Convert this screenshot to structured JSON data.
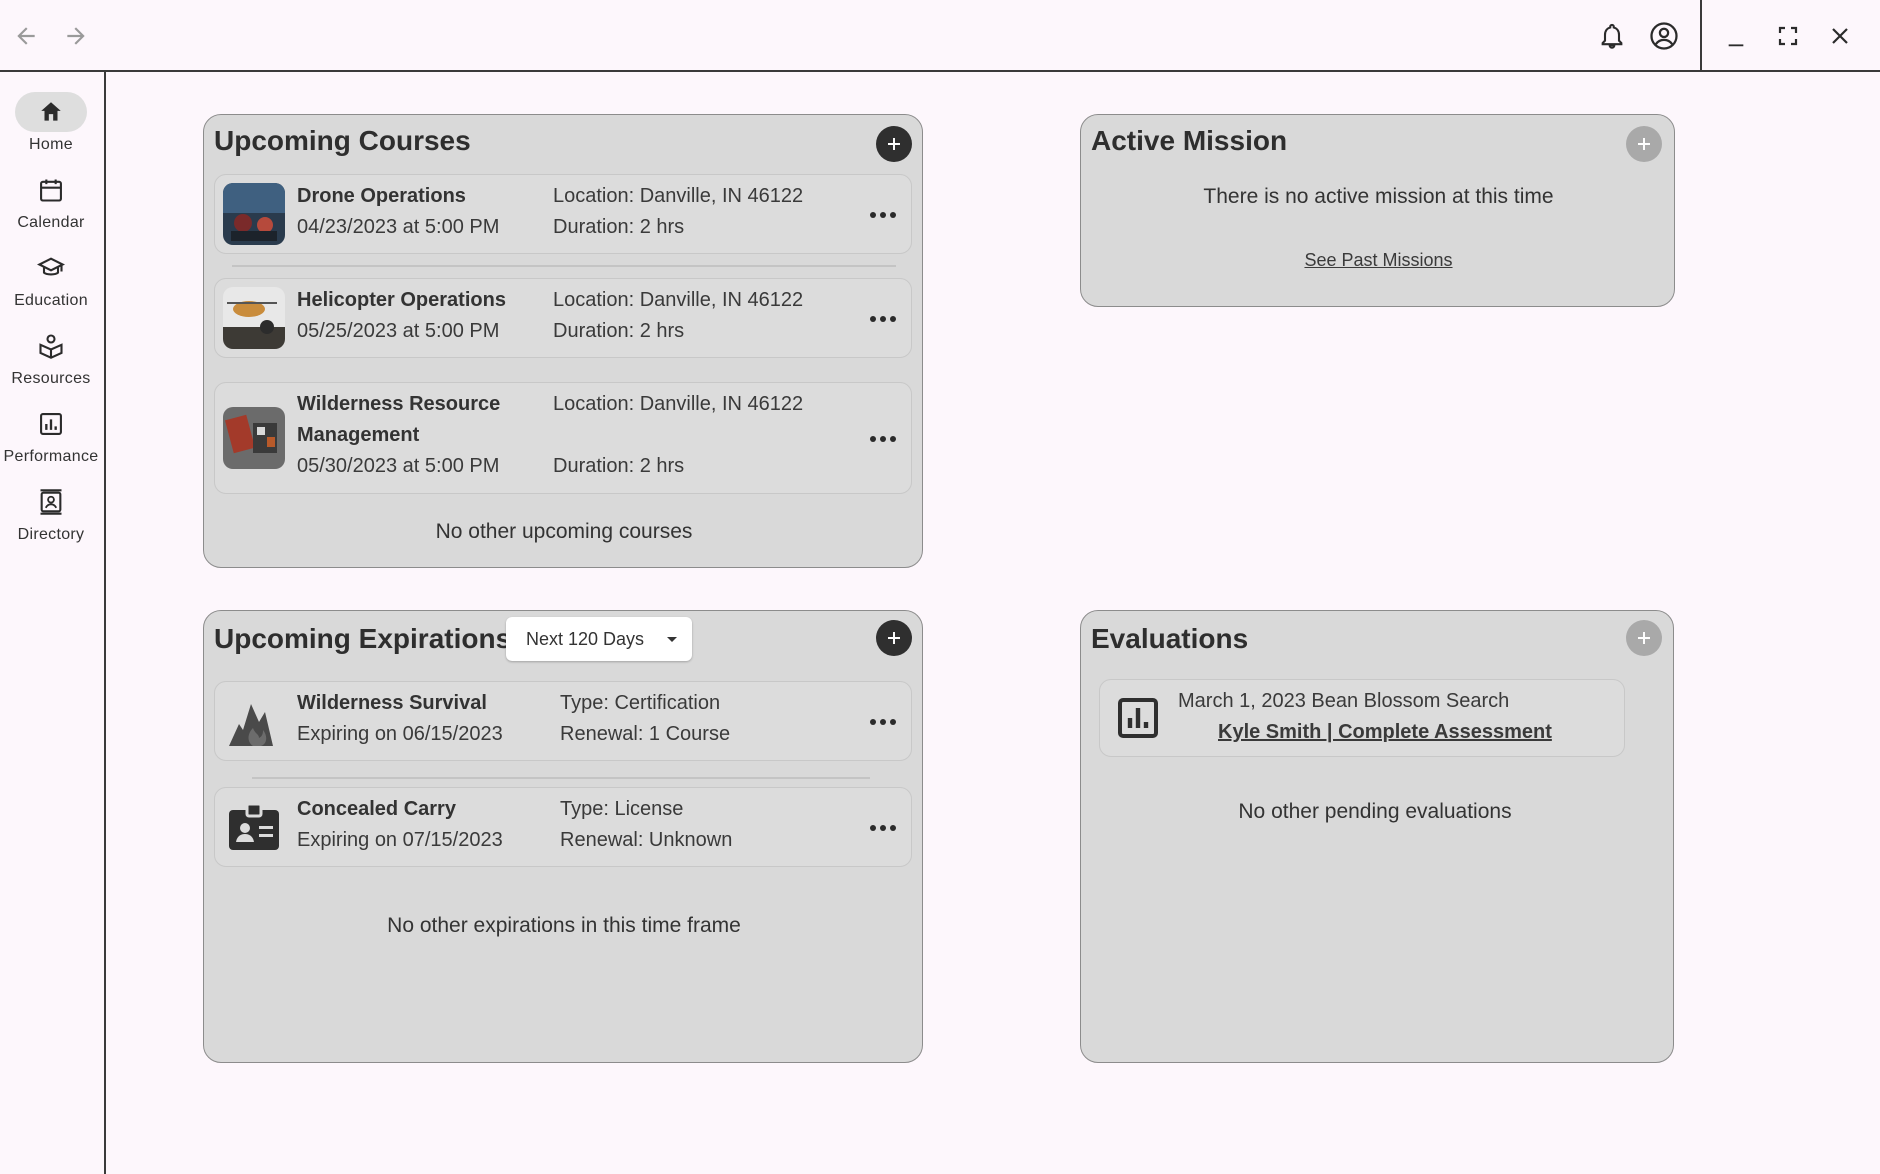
{
  "nav": {
    "items": [
      {
        "label": "Home",
        "icon": "home-icon"
      },
      {
        "label": "Calendar",
        "icon": "calendar-icon"
      },
      {
        "label": "Education",
        "icon": "education-icon"
      },
      {
        "label": "Resources",
        "icon": "resources-icon"
      },
      {
        "label": "Performance",
        "icon": "performance-icon"
      },
      {
        "label": "Directory",
        "icon": "directory-icon"
      }
    ]
  },
  "courses": {
    "title": "Upcoming Courses",
    "items": [
      {
        "name": "Drone Operations",
        "date": "04/23/2023 at 5:00 PM",
        "location": "Location: Danville, IN 46122",
        "duration": "Duration: 2 hrs"
      },
      {
        "name": "Helicopter Operations",
        "date": "05/25/2023 at 5:00 PM",
        "location": "Location: Danville, IN 46122",
        "duration": "Duration: 2 hrs"
      },
      {
        "name_line1": "Wilderness Resource",
        "name_line2": "Management",
        "date": "05/30/2023 at 5:00 PM",
        "location": "Location: Danville, IN 46122",
        "duration": "Duration: 2 hrs"
      }
    ],
    "empty_note": "No other upcoming courses"
  },
  "mission": {
    "title": "Active Mission",
    "status": "There is no active mission at this time",
    "past_link": "See Past Missions"
  },
  "expirations": {
    "title": "Upcoming Expirations",
    "filter": "Next 120 Days",
    "items": [
      {
        "name": "Wilderness Survival",
        "expiring": "Expiring on 06/15/2023",
        "type": "Type: Certification",
        "renewal": "Renewal: 1 Course",
        "icon": "fire-icon"
      },
      {
        "name": "Concealed Carry",
        "expiring": "Expiring on 07/15/2023",
        "type": "Type: License",
        "renewal": "Renewal: Unknown",
        "icon": "id-badge-icon"
      }
    ],
    "empty_note": "No other expirations in this time frame"
  },
  "evaluations": {
    "title": "Evaluations",
    "items": [
      {
        "title": "March 1, 2023 Bean Blossom Search",
        "link": "Kyle Smith | Complete Assessment"
      }
    ],
    "empty_note": "No other pending evaluations"
  },
  "colors": {
    "background": "#fdf7fc",
    "card": "#d9d9d9",
    "accent_dark": "#2f2f2f",
    "disabled": "#a9a9a9"
  }
}
